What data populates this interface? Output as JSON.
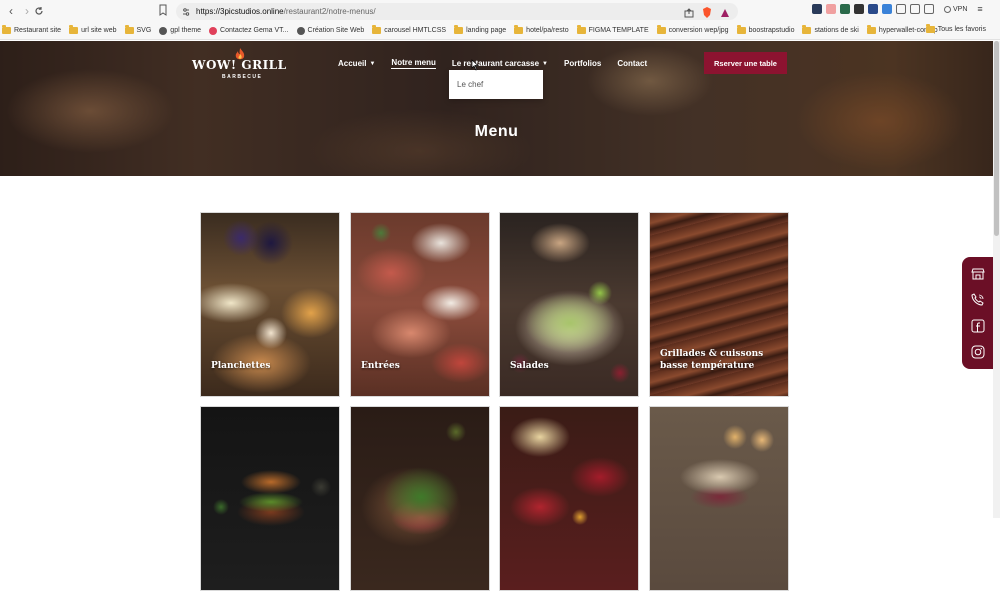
{
  "browser": {
    "url_host": "https://3picstudios.online",
    "url_path": "/restaurant2/notre-menus/",
    "vpn_label": "VPN",
    "bookmarks": [
      {
        "label": "Restaurant site",
        "icon": "folder-icon"
      },
      {
        "label": "url site web",
        "icon": "folder-icon"
      },
      {
        "label": "SVG",
        "icon": "folder-icon"
      },
      {
        "label": "gpl theme",
        "icon": "site-icon"
      },
      {
        "label": "Contactez Gema VT...",
        "icon": "site-icon"
      },
      {
        "label": "Création Site Web",
        "icon": "site-icon"
      },
      {
        "label": "carousel HMTLCSS",
        "icon": "folder-icon"
      },
      {
        "label": "landing page",
        "icon": "folder-icon"
      },
      {
        "label": "hotel/pa/resto",
        "icon": "folder-icon"
      },
      {
        "label": "FIGMA TEMPLATE",
        "icon": "folder-icon"
      },
      {
        "label": "conversion wep/jpg",
        "icon": "folder-icon"
      },
      {
        "label": "boostrapstudio",
        "icon": "folder-icon"
      },
      {
        "label": "stations de ski",
        "icon": "folder-icon"
      },
      {
        "label": "hyperwallet-comup",
        "icon": "folder-icon"
      }
    ],
    "all_bookmarks_label": "Tous les favoris"
  },
  "site": {
    "logo_main": "WOW! GRILL",
    "logo_sub": "BARBECUE",
    "nav": [
      {
        "label": "Accueil",
        "has_caret": true
      },
      {
        "label": "Notre menu",
        "active": true
      },
      {
        "label": "Le restaurant carcasse",
        "has_caret": true
      },
      {
        "label": "Portfolios"
      },
      {
        "label": "Contact"
      }
    ],
    "dropdown_items": [
      "Le chef"
    ],
    "reserve_button": "Rserver une table",
    "hero_title": "Menu"
  },
  "menu_cards": [
    {
      "label": "Planchettes"
    },
    {
      "label": "Entrées"
    },
    {
      "label": "Salades"
    },
    {
      "label": "Grillades & cuissons basse température"
    },
    {
      "label": ""
    },
    {
      "label": ""
    },
    {
      "label": ""
    },
    {
      "label": ""
    }
  ],
  "social": [
    "store-icon",
    "phone-icon",
    "facebook-icon",
    "instagram-icon"
  ],
  "colors": {
    "brand": "#8c1330",
    "social_bg": "#6b0f26"
  }
}
